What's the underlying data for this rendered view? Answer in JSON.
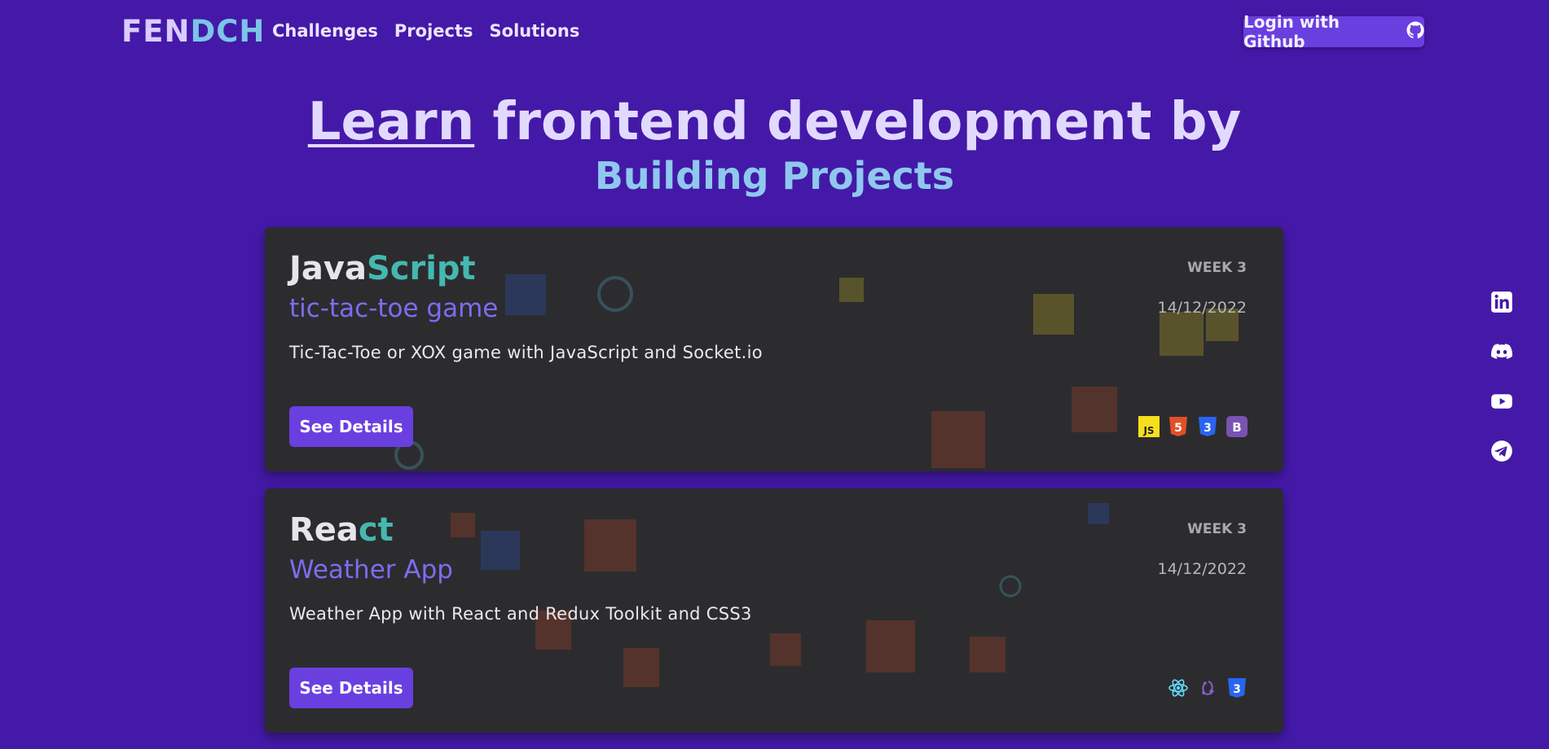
{
  "header": {
    "logo_part1": "FEN",
    "logo_part2": "DCH",
    "nav": [
      "Challenges",
      "Projects",
      "Solutions"
    ],
    "login_label": "Login with Github"
  },
  "hero": {
    "learn": "Learn",
    "rest": " frontend development by",
    "line2": "Building Projects"
  },
  "cards": [
    {
      "lang_a": "Java",
      "lang_b": "Script",
      "title": "tic-tac-toe game",
      "description": "Tic-Tac-Toe or XOX game with JavaScript and Socket.io",
      "week": "WEEK 3",
      "date": "14/12/2022",
      "button": "See Details",
      "tech_icons": [
        "javascript-icon",
        "html5-icon",
        "css3-icon",
        "bootstrap-icon"
      ]
    },
    {
      "lang_a": "Rea",
      "lang_b": "ct",
      "title": "Weather App",
      "description": "Weather App with React and Redux Toolkit and CSS3",
      "week": "WEEK 3",
      "date": "14/12/2022",
      "button": "See Details",
      "tech_icons": [
        "react-icon",
        "redux-icon",
        "css3-icon"
      ]
    }
  ],
  "social_icons": [
    "linkedin-icon",
    "discord-icon",
    "youtube-icon",
    "telegram-icon"
  ],
  "colors": {
    "background": "#4419a8",
    "card": "#2c2c2f",
    "accent": "#6a3fe0",
    "title_purple": "#7b6df0"
  }
}
